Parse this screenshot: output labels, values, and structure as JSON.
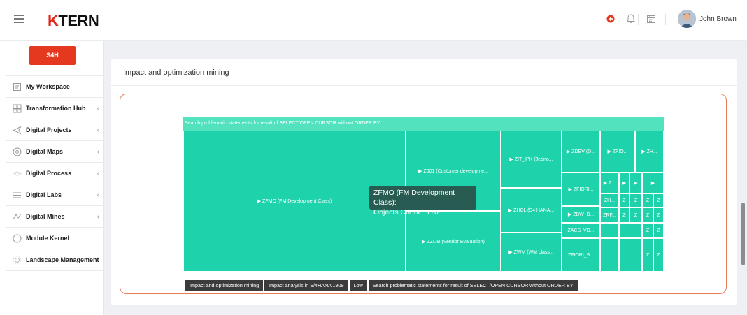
{
  "header": {
    "logo_text": "TERN",
    "logo_k": "K",
    "user_name": "John Brown",
    "icons": [
      "menu-icon",
      "plus-icon",
      "bell-icon",
      "calendar-icon",
      "avatar"
    ]
  },
  "sidebar": {
    "brand_button": "S4H",
    "items": [
      {
        "label": "My Workspace",
        "icon": "workspace-icon",
        "chevron": ""
      },
      {
        "label": "Transformation Hub",
        "icon": "grid-icon",
        "chevron": "‹"
      },
      {
        "label": "Digital Projects",
        "icon": "send-icon",
        "chevron": "‹"
      },
      {
        "label": "Digital Maps",
        "icon": "map-icon",
        "chevron": "‹"
      },
      {
        "label": "Digital Process",
        "icon": "process-icon",
        "chevron": "‹"
      },
      {
        "label": "Digital Labs",
        "icon": "list-icon",
        "chevron": "‹"
      },
      {
        "label": "Digital Mines",
        "icon": "mines-icon",
        "chevron": "‹"
      },
      {
        "label": "Module Kernel",
        "icon": "circle-icon",
        "chevron": ""
      },
      {
        "label": "Landscape Management",
        "icon": "settings-icon",
        "chevron": ""
      }
    ]
  },
  "main": {
    "panel_title": "Impact and optimization mining",
    "treemap": {
      "header": "Search problematic statements for result of SELECT/OPEN CURSOR without ORDER BY",
      "tiles": [
        "▶ ZFMO (FM Development Class)",
        "▶ Z001 (Customer developme...",
        "▶ ZZLIB (Vendor Evaluation)",
        "▶ ZIT_IPK (Jedno...",
        "▶ ZHCL (S4 HANA...",
        "▶ ZWM (WM class...",
        "▶ ZDEV (D...",
        "▶ ZFIO...",
        "▶ ZH...",
        "▶ ZFIORI...",
        "▶ Z...",
        "▶",
        "▶",
        "▶",
        "ZH...",
        "Z",
        "Z",
        "Z",
        "Z",
        "▶ ZBW_B...",
        "ZRF...",
        "Z",
        "Z",
        "Z",
        "Z",
        "ZACS_VD...",
        "Z",
        "Z",
        "ZFIORI_S...",
        "Z",
        "Z"
      ],
      "tooltip_line1": "ZFMO (FM Development Class):",
      "tooltip_line2": "Objects Count : 170"
    },
    "breadcrumb": [
      "Impact and optimization mining",
      "Impact analysis in S/4HANA 1909",
      "Low",
      "Search problematic statements for result of SELECT/OPEN CURSOR without ORDER BY"
    ]
  },
  "colors": {
    "accent": "#e5391f",
    "tile": "#1ed3ac",
    "tile_header": "#52e2bd",
    "tooltip": "#285c53",
    "frame": "#e8795b"
  }
}
